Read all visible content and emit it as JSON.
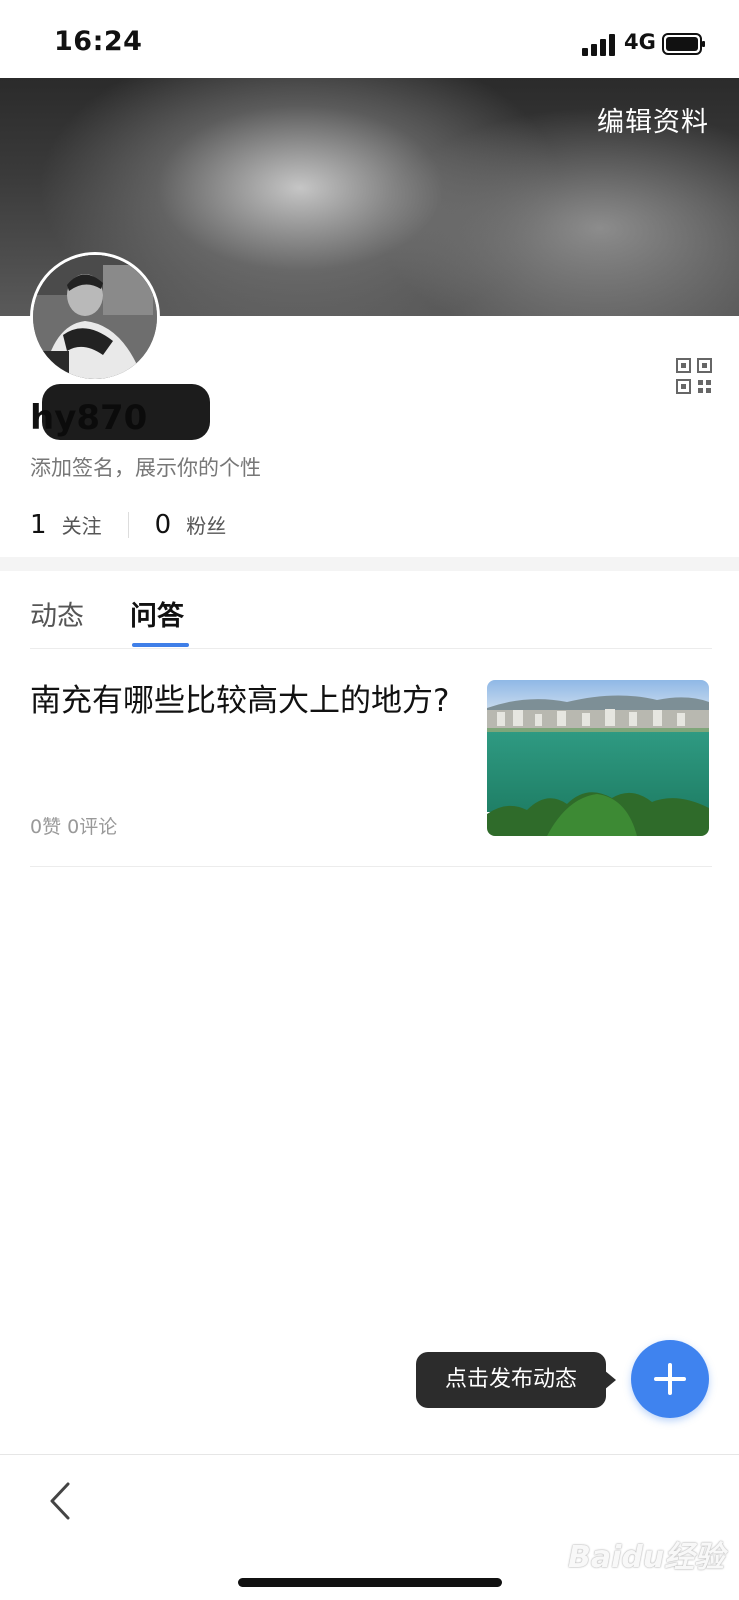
{
  "status_bar": {
    "time": "16:24",
    "network": "4G",
    "icons": [
      "signal-icon",
      "battery-icon"
    ]
  },
  "header": {
    "edit_profile_label": "编辑资料",
    "qr_icon": "qr-code-icon"
  },
  "profile": {
    "username": "hy870",
    "signature": "添加签名，展示你的个性",
    "following_count": "1",
    "following_label": "关注",
    "followers_count": "0",
    "followers_label": "粉丝"
  },
  "tabs": [
    {
      "label": "动态",
      "active": false
    },
    {
      "label": "问答",
      "active": true
    }
  ],
  "posts": [
    {
      "title": "南充有哪些比较高大上的地方?",
      "meta": "0赞 0评论"
    }
  ],
  "fab": {
    "tooltip": "点击发布动态",
    "icon": "plus-icon"
  },
  "nav": {
    "back_icon": "chevron-left-icon"
  },
  "watermark": "Baidu经验",
  "colors": {
    "accent": "#3f83ef",
    "tab_indicator": "#3f7fe8",
    "tooltip_bg": "#2c2c2c"
  }
}
